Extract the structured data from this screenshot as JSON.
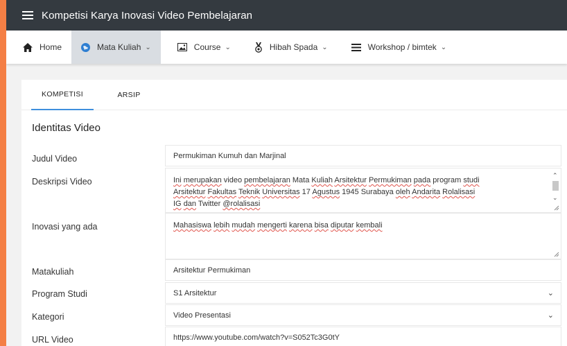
{
  "app": {
    "title": "Kompetisi Karya Inovasi Video Pembelajaran"
  },
  "nav": {
    "items": [
      {
        "label": "Home",
        "icon": "home-icon"
      },
      {
        "label": "Mata Kuliah",
        "icon": "globe-icon",
        "active": true
      },
      {
        "label": "Course",
        "icon": "image-icon"
      },
      {
        "label": "Hibah Spada",
        "icon": "medal-icon"
      },
      {
        "label": "Workshop / bimtek",
        "icon": "list-icon"
      }
    ]
  },
  "tabs": {
    "kompetisi": "KOMPETISI",
    "arsip": "ARSIP"
  },
  "section": {
    "title": "Identitas Video"
  },
  "form": {
    "judul": {
      "label": "Judul Video",
      "value": "Permukiman Kumuh dan Marjinal"
    },
    "deskripsi": {
      "label": "Deskripsi Video",
      "line1": [
        "Ini",
        " ",
        "merupakan",
        " video ",
        "pembelajaran",
        " Mata ",
        "Kuliah",
        " ",
        "Arsitektur",
        " ",
        "Permukiman",
        " ",
        "pada",
        " program ",
        "studi"
      ],
      "line2": [
        "Arsitektur",
        " ",
        "Fakultas",
        " ",
        "Teknik",
        " ",
        "Universitas",
        " 17 ",
        "Agustus",
        " 1945 Surabaya ",
        "oleh",
        " ",
        "Andarita",
        " ",
        "Rolalisasi"
      ],
      "line3": [
        "IG",
        " ",
        "dan",
        " Twitter ",
        "@rolalisasi"
      ]
    },
    "inovasi": {
      "label": "Inovasi yang ada",
      "line1": [
        "Mahasiswa",
        " ",
        "lebih",
        " ",
        "mudah",
        " ",
        "mengerti",
        " ",
        "karena",
        " ",
        "bisa",
        " ",
        "diputar",
        " ",
        "kembali"
      ]
    },
    "matakuliah": {
      "label": "Matakuliah",
      "value": "Arsitektur Permukiman"
    },
    "prodi": {
      "label": "Program Studi",
      "value": "S1 Arsitektur"
    },
    "kategori": {
      "label": "Kategori",
      "value": "Video Presentasi"
    },
    "url": {
      "label": "URL Video",
      "value": "https://www.youtube.com/watch?v=S052Tc3G0tY"
    }
  },
  "colors": {
    "frame": "#f47f45",
    "appbar": "#343a40",
    "tab_indicator": "#3e8fdd",
    "spellcheck": "#e0534b"
  }
}
